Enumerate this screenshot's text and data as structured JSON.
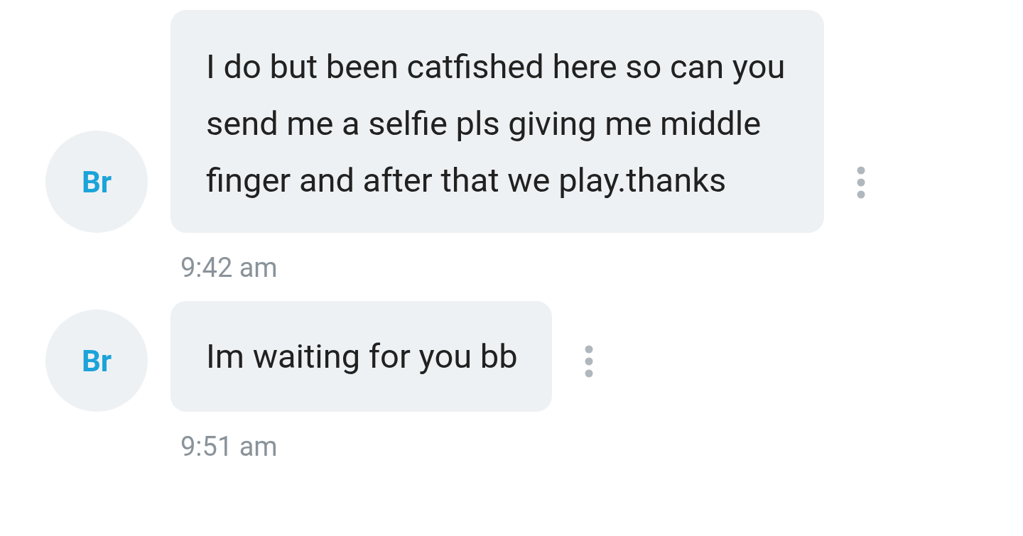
{
  "messages": [
    {
      "avatar": "Br",
      "text": "I do but been catfished here so can you send me a selfie pls giving me middle finger and after that we play.thanks",
      "time": "9:42 am"
    },
    {
      "avatar": "Br",
      "text": "Im waiting for you bb",
      "time": "9:51 am"
    }
  ]
}
